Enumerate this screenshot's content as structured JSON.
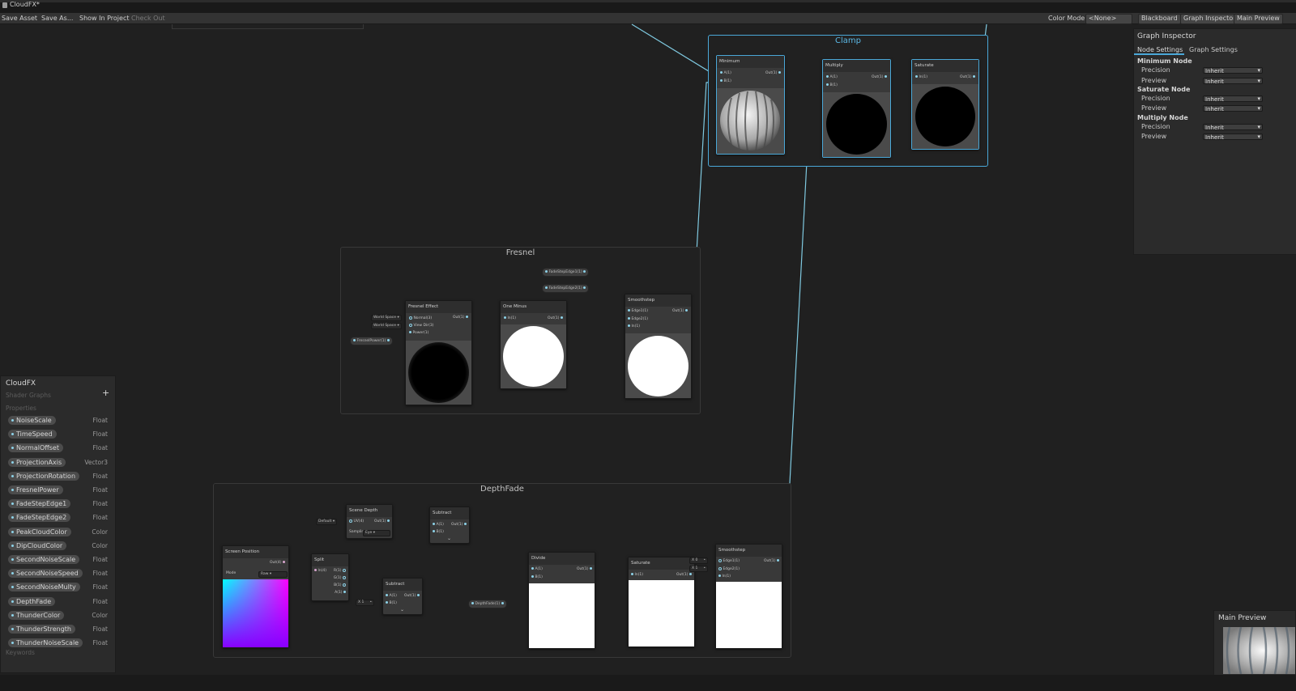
{
  "window": {
    "title": "CloudFX*"
  },
  "toolbar": {
    "save_asset": "Save Asset",
    "save_as": "Save As...",
    "show_in_project": "Show In Project",
    "check_out": "Check Out",
    "color_mode_label": "Color Mode",
    "color_mode_value": "<None>",
    "blackboard": "Blackboard",
    "graph_inspector": "Graph Inspector",
    "main_preview": "Main Preview"
  },
  "groups": {
    "clamp": "Clamp",
    "fresnel": "Fresnel",
    "depth_fade": "DepthFade"
  },
  "nodes": {
    "minimum": {
      "title": "Minimum",
      "in_a": "A(1)",
      "in_b": "B(1)",
      "out": "Out(1)"
    },
    "multiply": {
      "title": "Multiply",
      "in_a": "A(1)",
      "in_b": "B(1)",
      "out": "Out(1)"
    },
    "saturate_top": {
      "title": "Saturate",
      "in": "In(1)",
      "out": "Out(1)"
    },
    "fresnel_effect": {
      "title": "Fresnel Effect",
      "normal": "Normal(3)",
      "view_dir": "View Dir(3)",
      "power": "Power(1)",
      "out": "Out(1)",
      "world_space_1": "World Space",
      "world_space_2": "World Space"
    },
    "one_minus": {
      "title": "One Minus",
      "in": "In(1)",
      "out": "Out(1)"
    },
    "smoothstep_top": {
      "title": "Smoothstep",
      "edge1": "Edge1(1)",
      "edge2": "Edge2(1)",
      "in": "In(1)",
      "out": "Out(1)"
    },
    "screen_position": {
      "title": "Screen Position",
      "out": "Out(4)",
      "mode_label": "Mode",
      "mode_value": "Raw"
    },
    "split": {
      "title": "Split",
      "in": "In(4)",
      "r": "R(1)",
      "g": "G(1)",
      "b": "B(1)",
      "a": "A(1)"
    },
    "scene_depth": {
      "title": "Scene Depth",
      "uv": "UV(4)",
      "out": "Out(1)",
      "uv_default": "Default",
      "sampling_label": "Samplin",
      "sampling_value": "Eye"
    },
    "subtract_top": {
      "title": "Subtract",
      "in_a": "A(1)",
      "in_b": "B(1)",
      "out": "Out(1)"
    },
    "subtract_bottom": {
      "title": "Subtract",
      "in_a": "A(1)",
      "in_b": "B(1)",
      "out": "Out(1)",
      "x_label": "X",
      "x_value": "1"
    },
    "divide": {
      "title": "Divide",
      "in_a": "A(1)",
      "in_b": "B(1)",
      "out": "Out(1)"
    },
    "saturate_bottom": {
      "title": "Saturate",
      "in": "In(1)",
      "out": "Out(1)"
    },
    "smoothstep_bottom": {
      "title": "Smoothstep",
      "edge1": "Edge1(1)",
      "edge2": "Edge2(1)",
      "in": "In(1)",
      "out": "Out(1)",
      "x1_label": "X",
      "x1_value": "0",
      "x2_label": "X",
      "x2_value": "1"
    }
  },
  "property_chips": {
    "fade1": "FadeStepEdge1(1)",
    "fade2": "FadeStepEdge2(1)",
    "fresnel_power": "FresnelPower(1)",
    "depth_fade": "DepthFade(1)"
  },
  "blackboard": {
    "title": "CloudFX",
    "subtitle": "Shader Graphs",
    "add_symbol": "+",
    "properties_label": "Properties",
    "keywords_label": "Keywords",
    "properties": [
      {
        "name": "NoiseScale",
        "type": "Float"
      },
      {
        "name": "TimeSpeed",
        "type": "Float"
      },
      {
        "name": "NormalOffset",
        "type": "Float"
      },
      {
        "name": "ProjectionAxis",
        "type": "Vector3"
      },
      {
        "name": "ProjectionRotation",
        "type": "Float"
      },
      {
        "name": "FresnelPower",
        "type": "Float"
      },
      {
        "name": "FadeStepEdge1",
        "type": "Float"
      },
      {
        "name": "FadeStepEdge2",
        "type": "Float"
      },
      {
        "name": "PeakCloudColor",
        "type": "Color"
      },
      {
        "name": "DipCloudColor",
        "type": "Color"
      },
      {
        "name": "SecondNoiseScale",
        "type": "Float"
      },
      {
        "name": "SecondNoiseSpeed",
        "type": "Float"
      },
      {
        "name": "SecondNoiseMulty",
        "type": "Float"
      },
      {
        "name": "DepthFade",
        "type": "Float"
      },
      {
        "name": "ThunderColor",
        "type": "Color"
      },
      {
        "name": "ThunderStrength",
        "type": "Float"
      },
      {
        "name": "ThunderNoiseScale",
        "type": "Float"
      }
    ]
  },
  "inspector": {
    "title": "Graph Inspector",
    "tab_node": "Node Settings",
    "tab_graph": "Graph Settings",
    "sections": [
      {
        "header": "Minimum Node",
        "precision_label": "Precision",
        "precision_value": "Inherit",
        "preview_label": "Preview",
        "preview_value": "Inherit"
      },
      {
        "header": "Saturate Node",
        "precision_label": "Precision",
        "precision_value": "Inherit",
        "preview_label": "Preview",
        "preview_value": "Inherit"
      },
      {
        "header": "Multiply Node",
        "precision_label": "Precision",
        "precision_value": "Inherit",
        "preview_label": "Preview",
        "preview_value": "Inherit"
      }
    ]
  },
  "main_preview": {
    "title": "Main Preview"
  },
  "colors": {
    "accent": "#4aa8d8",
    "wire": "#7fc9e0",
    "canvas": "#202020",
    "panel": "#2b2b2b"
  }
}
